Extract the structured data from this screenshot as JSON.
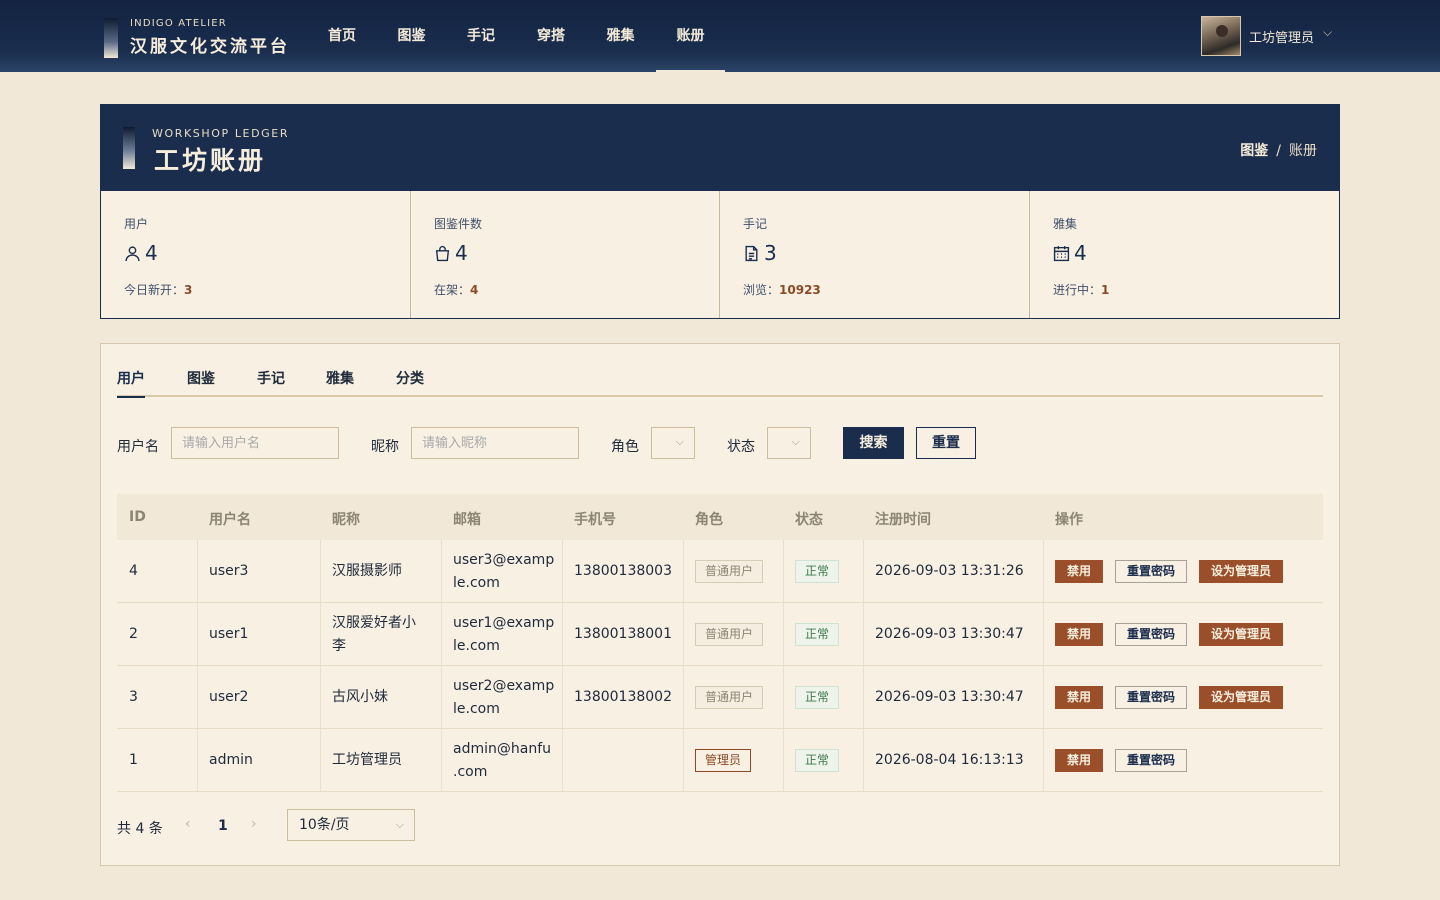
{
  "brand": {
    "en": "INDIGO ATELIER",
    "cn": "汉服文化交流平台"
  },
  "nav": {
    "items": [
      {
        "label": "首页",
        "active": false
      },
      {
        "label": "图鉴",
        "active": false
      },
      {
        "label": "手记",
        "active": false
      },
      {
        "label": "穿搭",
        "active": false
      },
      {
        "label": "雅集",
        "active": false
      },
      {
        "label": "账册",
        "active": true
      }
    ]
  },
  "user": {
    "name": "工坊管理员",
    "chevron": "⌵"
  },
  "ledger": {
    "en": "WORKSHOP LEDGER",
    "cn": "工坊账册",
    "breadcrumb": {
      "parent": "图鉴",
      "sep": "/",
      "current": "账册"
    }
  },
  "stats": [
    {
      "label": "用户",
      "icon": "user-icon",
      "value": "4",
      "sub_label": "今日新开：",
      "sub_value": "3"
    },
    {
      "label": "图鉴件数",
      "icon": "bag-icon",
      "value": "4",
      "sub_label": "在架：",
      "sub_value": "4"
    },
    {
      "label": "手记",
      "icon": "document-icon",
      "value": "3",
      "sub_label": "浏览：",
      "sub_value": "10923"
    },
    {
      "label": "雅集",
      "icon": "calendar-icon",
      "value": "4",
      "sub_label": "进行中：",
      "sub_value": "1"
    }
  ],
  "tabs": [
    {
      "label": "用户",
      "active": true
    },
    {
      "label": "图鉴",
      "active": false
    },
    {
      "label": "手记",
      "active": false
    },
    {
      "label": "雅集",
      "active": false
    },
    {
      "label": "分类",
      "active": false
    }
  ],
  "filters": {
    "username_label": "用户名",
    "username_placeholder": "请输入用户名",
    "nickname_label": "昵称",
    "nickname_placeholder": "请输入昵称",
    "role_label": "角色",
    "status_label": "状态",
    "search_label": "搜索",
    "reset_label": "重置"
  },
  "table": {
    "headers": [
      "ID",
      "用户名",
      "昵称",
      "邮箱",
      "手机号",
      "角色",
      "状态",
      "注册时间",
      "操作"
    ],
    "rows": [
      {
        "id": "4",
        "username": "user3",
        "nickname_1": "汉服摄影师",
        "nickname_2": "",
        "email_1": "user3@examp",
        "email_2": "le.com",
        "phone": "13800138003",
        "role": "普通用户",
        "status": "正常",
        "registered": "2026-09-03 13:31:26",
        "ban": "禁用",
        "reset_pw": "重置密码",
        "make_admin": "设为管理员"
      },
      {
        "id": "2",
        "username": "user1",
        "nickname_1": "汉服爱好者小",
        "nickname_2": "李",
        "email_1": "user1@examp",
        "email_2": "le.com",
        "phone": "13800138001",
        "role": "普通用户",
        "status": "正常",
        "registered": "2026-09-03 13:30:47",
        "ban": "禁用",
        "reset_pw": "重置密码",
        "make_admin": "设为管理员"
      },
      {
        "id": "3",
        "username": "user2",
        "nickname_1": "古风小妹",
        "nickname_2": "",
        "email_1": "user2@examp",
        "email_2": "le.com",
        "phone": "13800138002",
        "role": "普通用户",
        "status": "正常",
        "registered": "2026-09-03 13:30:47",
        "ban": "禁用",
        "reset_pw": "重置密码",
        "make_admin": "设为管理员"
      },
      {
        "id": "1",
        "username": "admin",
        "nickname_1": "工坊管理员",
        "nickname_2": "",
        "email_1": "admin@hanfu",
        "email_2": ".com",
        "phone": "",
        "role": "管理员",
        "status": "正常",
        "registered": "2026-08-04 16:13:13",
        "ban": "禁用",
        "reset_pw": "重置密码",
        "make_admin": ""
      }
    ]
  },
  "pagination": {
    "total": "共 4 条",
    "prev": "‹",
    "current": "1",
    "next": "›",
    "page_size": "10条/页",
    "page_size_chevron": "⌵"
  }
}
